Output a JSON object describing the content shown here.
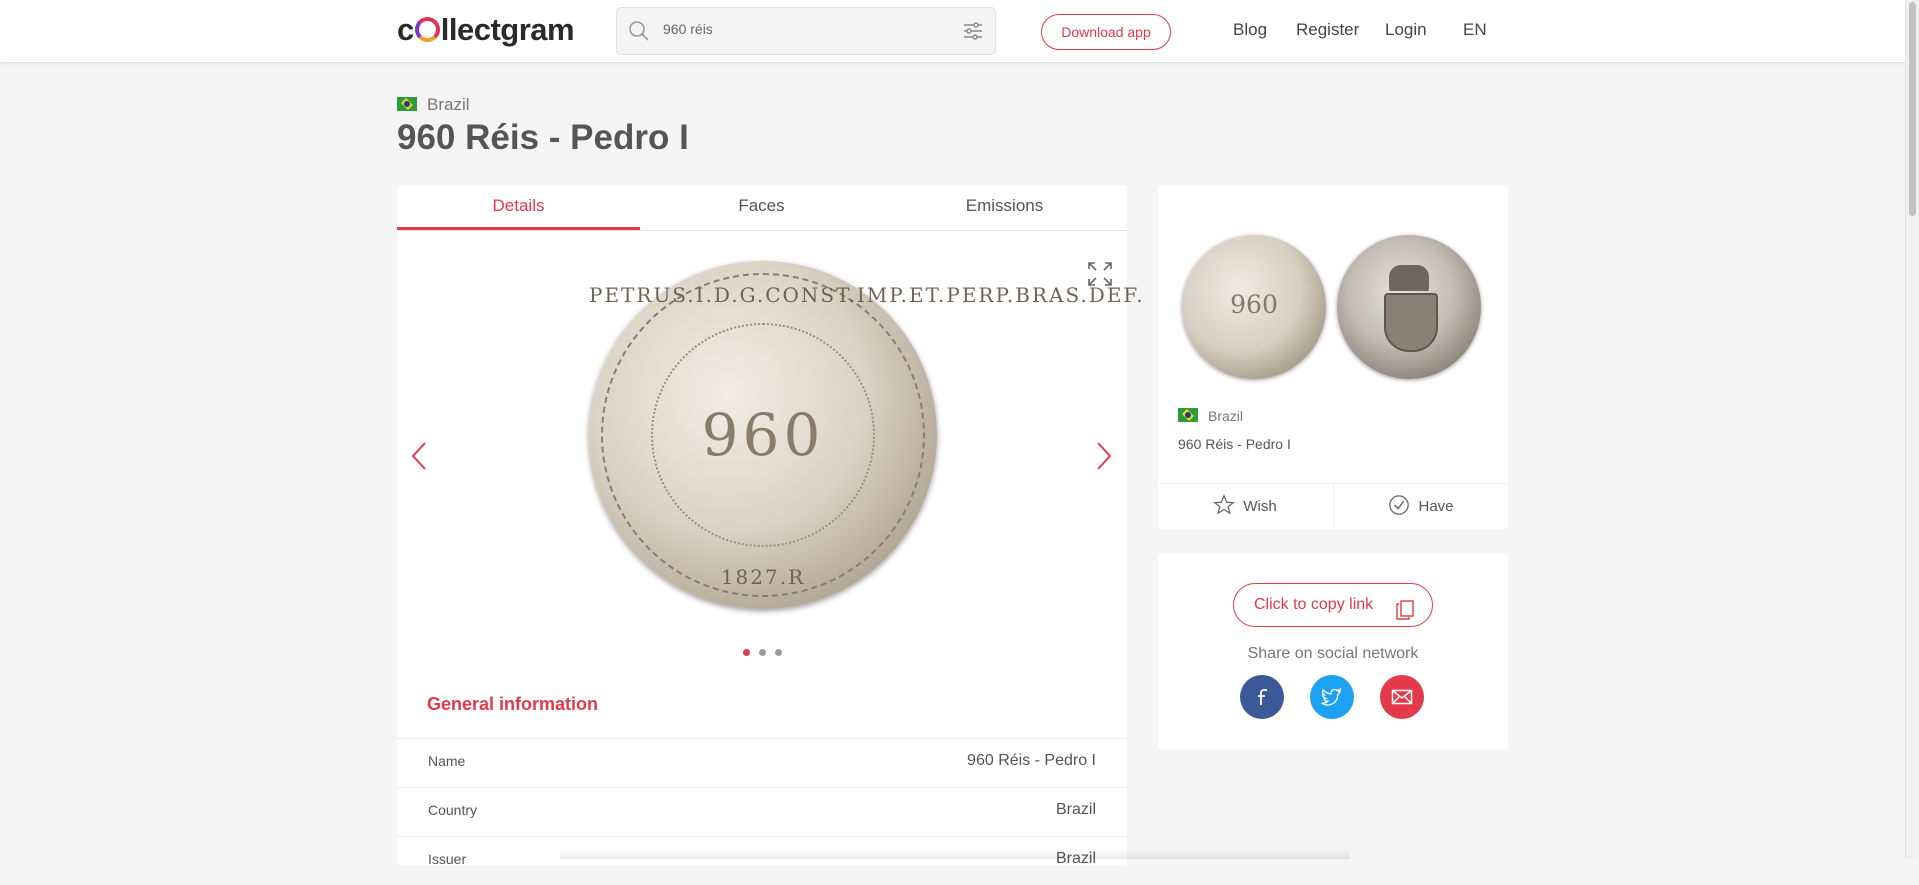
{
  "header": {
    "logo": "collectgram",
    "search": {
      "value": "960 réis",
      "placeholder": ""
    },
    "download_label": "Download app",
    "nav": [
      "Blog",
      "Register",
      "Login",
      "EN"
    ]
  },
  "breadcrumb": {
    "country": "Brazil"
  },
  "page_title": "960 Réis - Pedro I",
  "tabs": [
    "Details",
    "Faces",
    "Emissions"
  ],
  "gallery": {
    "coin_value": "960",
    "legend": "PETRUS.I.D.G.CONST.IMP.ET.PERP.BRAS.DEF.",
    "year": "1827.R",
    "dots": 3,
    "active_dot": 1
  },
  "general_info": {
    "title": "General information",
    "rows": [
      {
        "key": "Name",
        "value": "960 Réis - Pedro I"
      },
      {
        "key": "Country",
        "value": "Brazil"
      },
      {
        "key": "Issuer",
        "value": "Brazil"
      }
    ]
  },
  "side_card": {
    "coin_value": "960",
    "country": "Brazil",
    "name": "960 Réis - Pedro I",
    "wish_label": "Wish",
    "have_label": "Have"
  },
  "share": {
    "copy_label": "Click to copy link",
    "share_label": "Share on social network"
  },
  "colors": {
    "accent": "#e23a4a",
    "facebook": "#3b5998",
    "twitter": "#1da1f2",
    "email": "#e23a4a"
  },
  "icons": [
    "search-icon",
    "filter-icon",
    "expand-icon",
    "chevron-left-icon",
    "chevron-right-icon",
    "star-icon",
    "check-circle-icon",
    "copy-icon",
    "facebook-icon",
    "twitter-icon",
    "mail-icon"
  ]
}
